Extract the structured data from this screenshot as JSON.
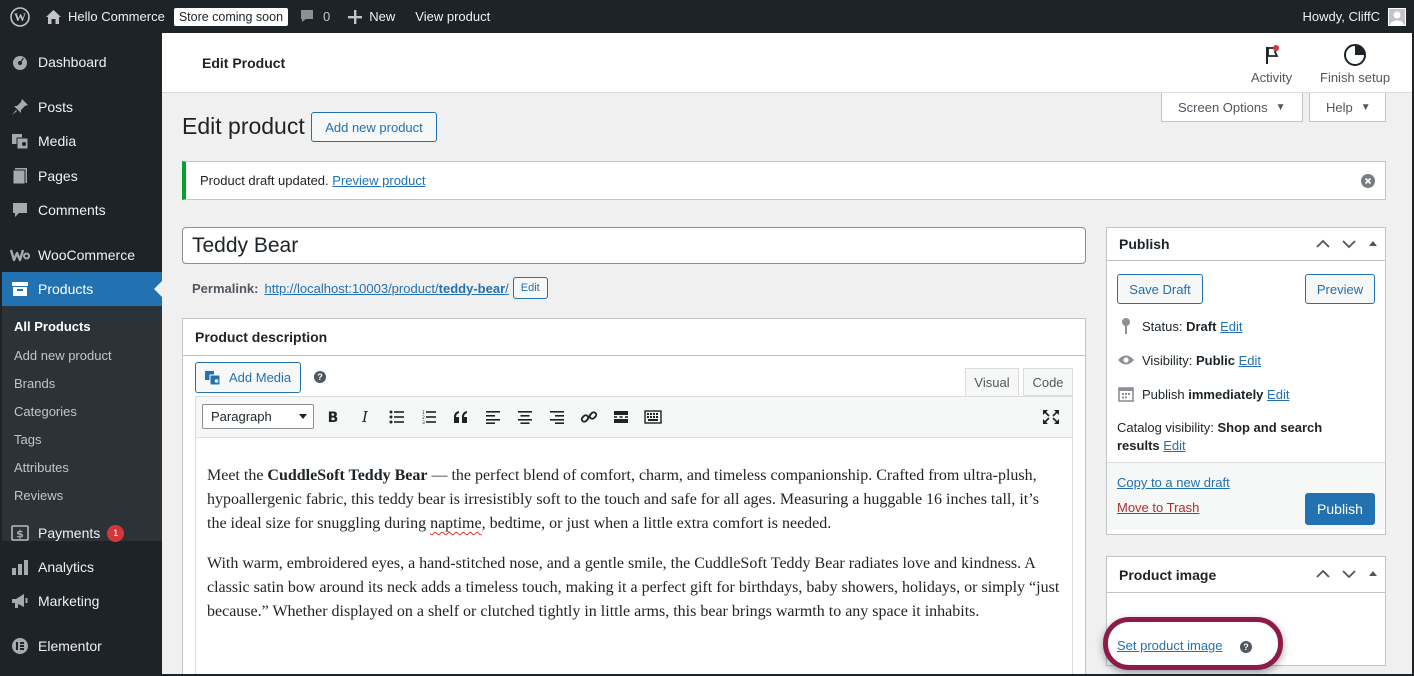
{
  "adminbar": {
    "site_name": "Hello Commerce",
    "store_badge": "Store coming soon",
    "comments_count": "0",
    "new_label": "New",
    "view_product": "View product",
    "howdy": "Howdy, CliffC"
  },
  "sidebar": {
    "items": {
      "dashboard": "Dashboard",
      "posts": "Posts",
      "media": "Media",
      "pages": "Pages",
      "comments": "Comments",
      "woocommerce": "WooCommerce",
      "products": "Products",
      "payments": "Payments",
      "payments_badge": "1",
      "analytics": "Analytics",
      "marketing": "Marketing",
      "elementor": "Elementor"
    },
    "submenu": {
      "all_products": "All Products",
      "add_new": "Add new product",
      "brands": "Brands",
      "categories": "Categories",
      "tags": "Tags",
      "attributes": "Attributes",
      "reviews": "Reviews"
    }
  },
  "wc_header": {
    "title": "Edit Product",
    "activity": "Activity",
    "finish_setup": "Finish setup"
  },
  "screen_options": "Screen Options",
  "help": "Help",
  "page": {
    "title": "Edit product",
    "add_new": "Add new product"
  },
  "notice": {
    "text": "Product draft updated.",
    "link": "Preview product"
  },
  "product": {
    "title": "Teddy Bear",
    "permalink_label": "Permalink:",
    "permalink_base": "http://localhost:10003/product/",
    "permalink_slug": "teddy-bear",
    "permalink_end": "/",
    "permalink_edit": "Edit"
  },
  "description": {
    "heading": "Product description",
    "add_media": "Add Media",
    "tab_visual": "Visual",
    "tab_code": "Code",
    "format": "Paragraph",
    "p1_a": "Meet the ",
    "p1_bold": "CuddleSoft Teddy Bear",
    "p1_b": " — the perfect blend of comfort, charm, and timeless companionship. Crafted from ultra-plush, hypoallergenic fabric, this teddy bear is irresistibly soft to the touch and safe for all ages. Measuring a huggable 16 inches tall, it’s the ideal size for snuggling during ",
    "p1_spell": "naptime",
    "p1_c": ", bedtime, or just when a little extra comfort is needed.",
    "p2": "With warm, embroidered eyes, a hand-stitched nose, and a gentle smile, the CuddleSoft Teddy Bear radiates love and kindness. A classic satin bow around its neck adds a timeless touch, making it a perfect gift for birthdays, baby showers, holidays, or simply “just because.” Whether displayed on a shelf or clutched tightly in little arms, this bear brings warmth to any space it inhabits."
  },
  "publish": {
    "heading": "Publish",
    "save_draft": "Save Draft",
    "preview": "Preview",
    "status_label": "Status:",
    "status_value": "Draft",
    "visibility_label": "Visibility:",
    "visibility_value": "Public",
    "publish_label": "Publish",
    "publish_value": "immediately",
    "edit": "Edit",
    "catalog_label": "Catalog visibility:",
    "catalog_value_1": "Shop and search",
    "catalog_value_2": "results",
    "copy_draft": "Copy to a new draft",
    "trash": "Move to Trash",
    "publish_btn": "Publish"
  },
  "product_image": {
    "heading": "Product image",
    "set_image": "Set product image"
  },
  "colors": {
    "accent": "#2271b1",
    "adminbar": "#1d2327",
    "success": "#00a32a",
    "danger": "#d63638",
    "highlight": "#8c1b4a"
  }
}
